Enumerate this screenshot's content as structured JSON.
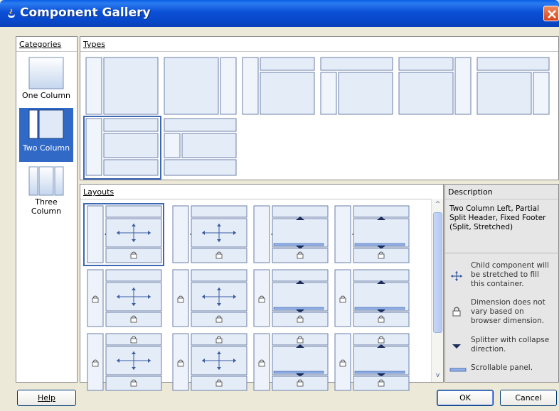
{
  "window": {
    "title": "Component Gallery",
    "close_icon": "close-icon"
  },
  "categories": {
    "header": "Categories",
    "items": [
      {
        "label": "One Column",
        "icon": "one-column-icon",
        "selected": false
      },
      {
        "label": "Two Column",
        "icon": "two-column-icon",
        "selected": true
      },
      {
        "label": "Three Column",
        "icon": "three-column-icon",
        "selected": false
      }
    ]
  },
  "types": {
    "header": "Types",
    "thumbnails": [
      {
        "name": "type-left-column",
        "selected": false
      },
      {
        "name": "type-right-column",
        "selected": false
      },
      {
        "name": "type-left-column-header",
        "selected": false
      },
      {
        "name": "type-header-left-column",
        "selected": false
      },
      {
        "name": "type-header-right-column",
        "selected": false
      },
      {
        "name": "type-header-right-column-right",
        "selected": false
      },
      {
        "name": "type-left-split-header-footer",
        "selected": true
      },
      {
        "name": "type-header-left-footer",
        "selected": false
      }
    ]
  },
  "layouts": {
    "header": "Layouts",
    "selected_index": 0
  },
  "description": {
    "header": "Description",
    "text": "Two Column Left, Partial Split Header, Fixed Footer (Split, Stretched)",
    "legend": [
      {
        "icon": "stretch-arrows-icon",
        "text": "Child component will be stretched to fill this container."
      },
      {
        "icon": "lock-icon",
        "text": "Dimension does not vary based on browser dimension."
      },
      {
        "icon": "splitter-collapse-icon",
        "text": "Splitter with collapse direction."
      },
      {
        "icon": "scrollable-panel-icon",
        "text": "Scrollable panel."
      }
    ]
  },
  "buttons": {
    "help": "Help",
    "ok": "OK",
    "cancel": "Cancel"
  },
  "colors": {
    "titlebar": "#0b4fd6",
    "selection": "#3169c6",
    "dialog_bg": "#ece9d8",
    "close_button": "#d9431a"
  }
}
